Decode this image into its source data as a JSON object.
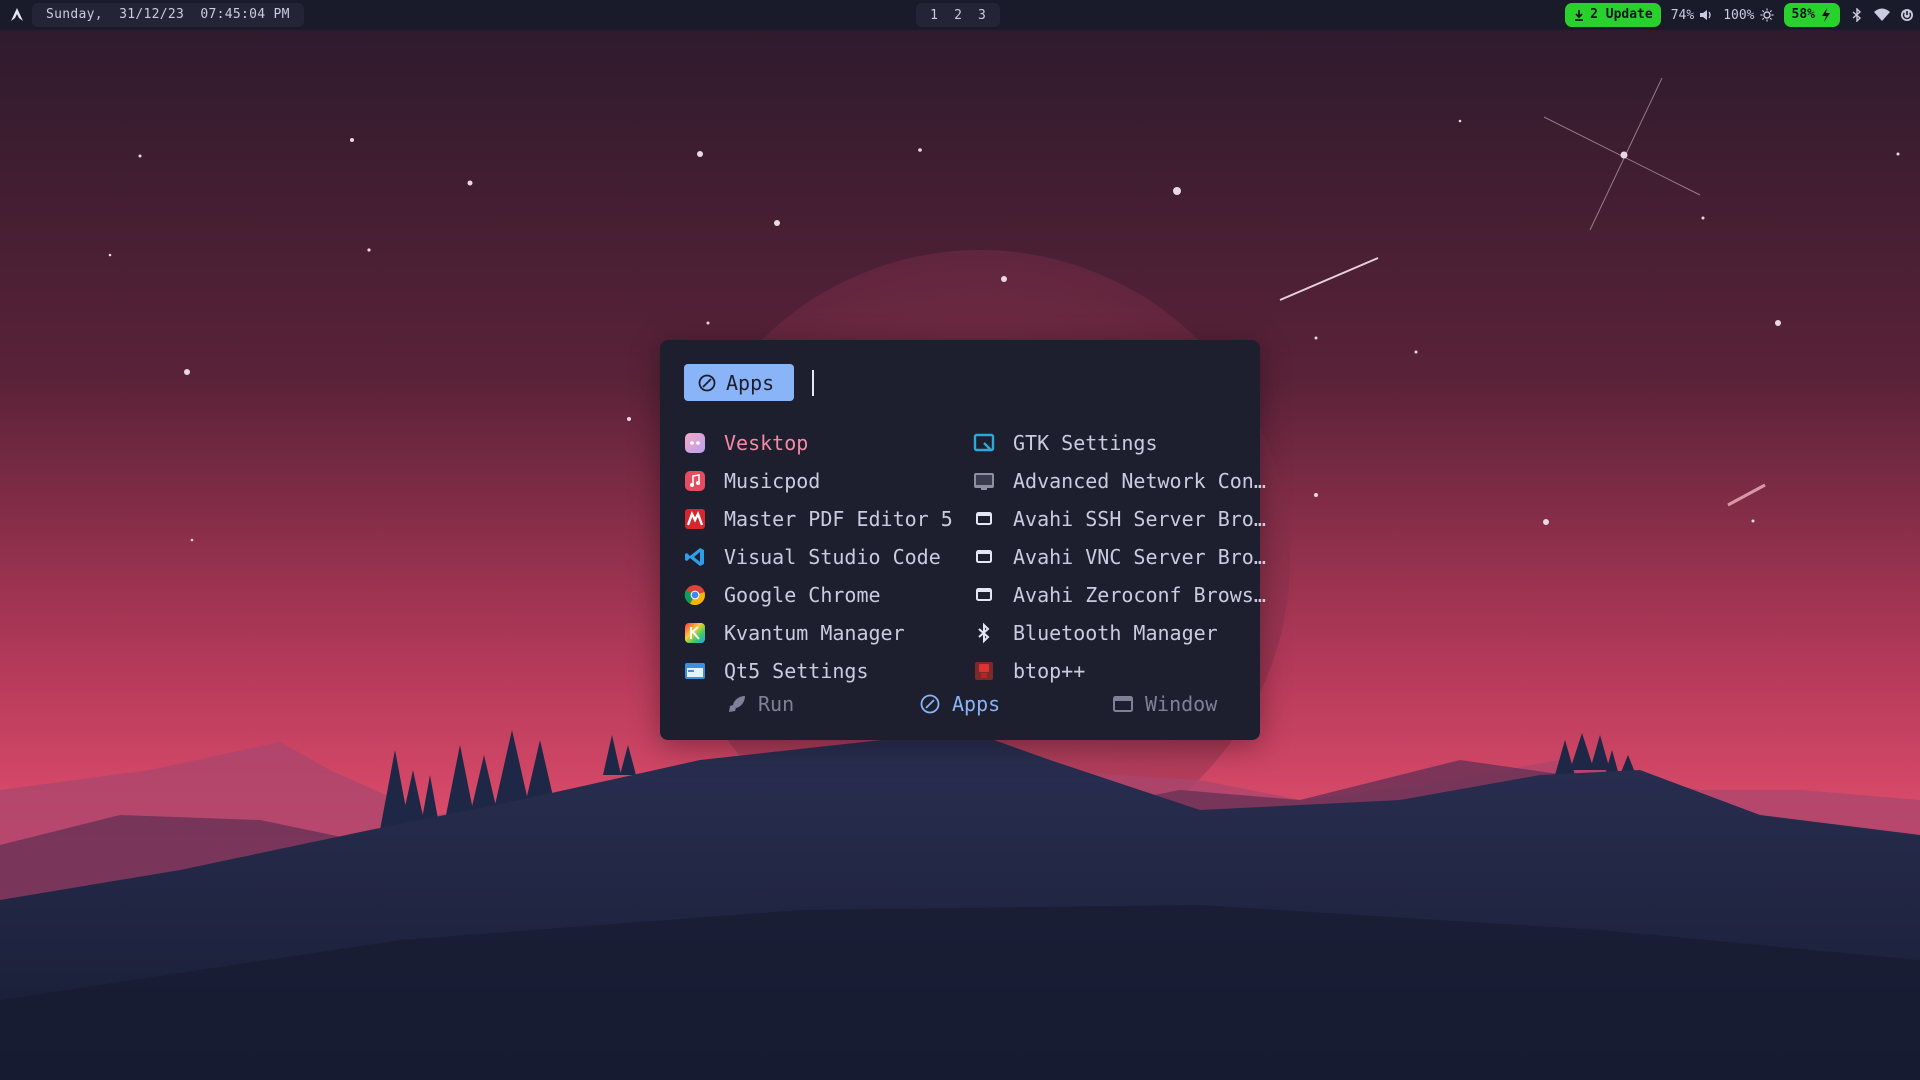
{
  "topbar": {
    "logo_icon": "arch-icon",
    "clock": "Sunday,  31/12/23  07:45:04 PM",
    "workspaces": [
      "1",
      "2",
      "3"
    ],
    "update": "2 Update",
    "volume": "74%",
    "brightness": "100%",
    "battery": "58%",
    "icons": [
      "download-icon",
      "volume-icon",
      "brightness-icon",
      "charging-icon",
      "bluetooth-icon",
      "wifi-icon",
      "power-icon"
    ]
  },
  "launcher": {
    "mode": "Apps",
    "search_value": "",
    "apps_left": [
      {
        "label": "Vesktop",
        "icon": "vesktop-icon",
        "selected": true
      },
      {
        "label": "Musicpod",
        "icon": "musicpod-icon"
      },
      {
        "label": "Master PDF Editor 5",
        "icon": "master-pdf-icon"
      },
      {
        "label": "Visual Studio Code",
        "icon": "vscode-icon"
      },
      {
        "label": "Google Chrome",
        "icon": "chrome-icon"
      },
      {
        "label": "Kvantum Manager",
        "icon": "kvantum-icon"
      },
      {
        "label": "Qt5 Settings",
        "icon": "qt5-settings-icon"
      }
    ],
    "apps_right": [
      {
        "label": "GTK Settings",
        "icon": "gtk-settings-icon"
      },
      {
        "label": "Advanced Network Con…",
        "icon": "network-icon"
      },
      {
        "label": "Avahi SSH Server Bro…",
        "icon": "window-icon"
      },
      {
        "label": "Avahi VNC Server Bro…",
        "icon": "window-icon"
      },
      {
        "label": "Avahi Zeroconf Brows…",
        "icon": "window-icon"
      },
      {
        "label": "Bluetooth Manager",
        "icon": "bluetooth-icon"
      },
      {
        "label": "btop++",
        "icon": "btop-icon"
      }
    ],
    "footer": {
      "run": "Run",
      "apps": "Apps",
      "window": "Window"
    }
  },
  "colors": {
    "accent": "#8ab4f8",
    "selected_text": "#f38ba8",
    "status_green": "#29d12c"
  }
}
